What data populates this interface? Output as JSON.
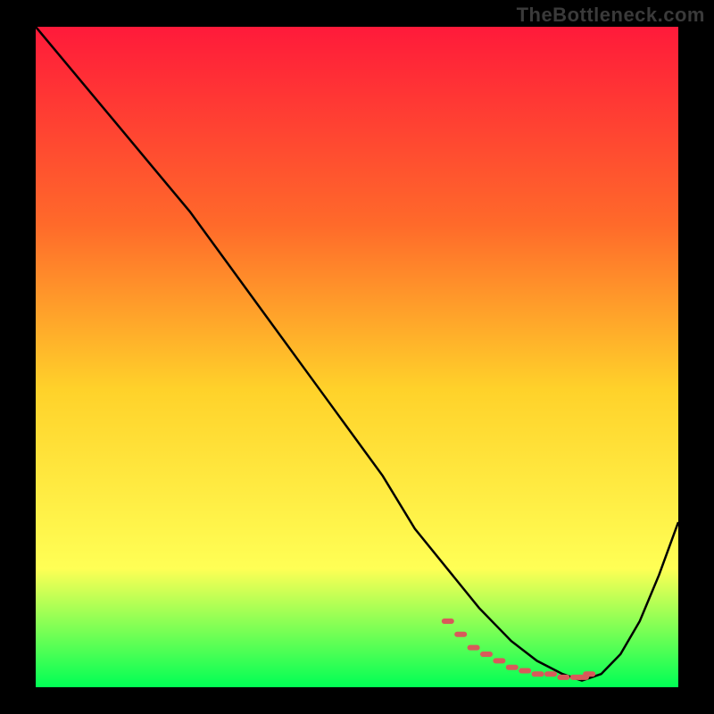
{
  "watermark": "TheBottleneck.com",
  "colors": {
    "page_background": "#000000",
    "gradient_top": "#ff1a3a",
    "gradient_mid1": "#ff6a2a",
    "gradient_mid2": "#ffd22a",
    "gradient_mid3": "#ffff55",
    "gradient_bottom": "#00ff55",
    "curve": "#000000",
    "marker": "#d85a5a"
  },
  "chart_data": {
    "type": "line",
    "title": "",
    "subtitle": "",
    "xlabel": "",
    "ylabel": "",
    "xlim": [
      0,
      100
    ],
    "ylim": [
      0,
      100
    ],
    "legend": false,
    "grid": false,
    "annotations": [],
    "series": [
      {
        "name": "bottleneck-curve",
        "x": [
          0,
          6,
          12,
          18,
          24,
          30,
          36,
          42,
          48,
          54,
          59,
          64,
          69,
          74,
          78,
          82,
          85,
          88,
          91,
          94,
          97,
          100
        ],
        "values": [
          100,
          93,
          86,
          79,
          72,
          64,
          56,
          48,
          40,
          32,
          24,
          18,
          12,
          7,
          4,
          2,
          1,
          2,
          5,
          10,
          17,
          25
        ]
      }
    ],
    "markers": {
      "name": "highlight-band",
      "x": [
        64,
        66,
        68,
        70,
        72,
        74,
        76,
        78,
        80,
        82,
        84,
        85,
        86
      ],
      "values": [
        10,
        8,
        6,
        5,
        4,
        3,
        2.5,
        2,
        2,
        1.5,
        1.5,
        1.5,
        2
      ]
    }
  }
}
